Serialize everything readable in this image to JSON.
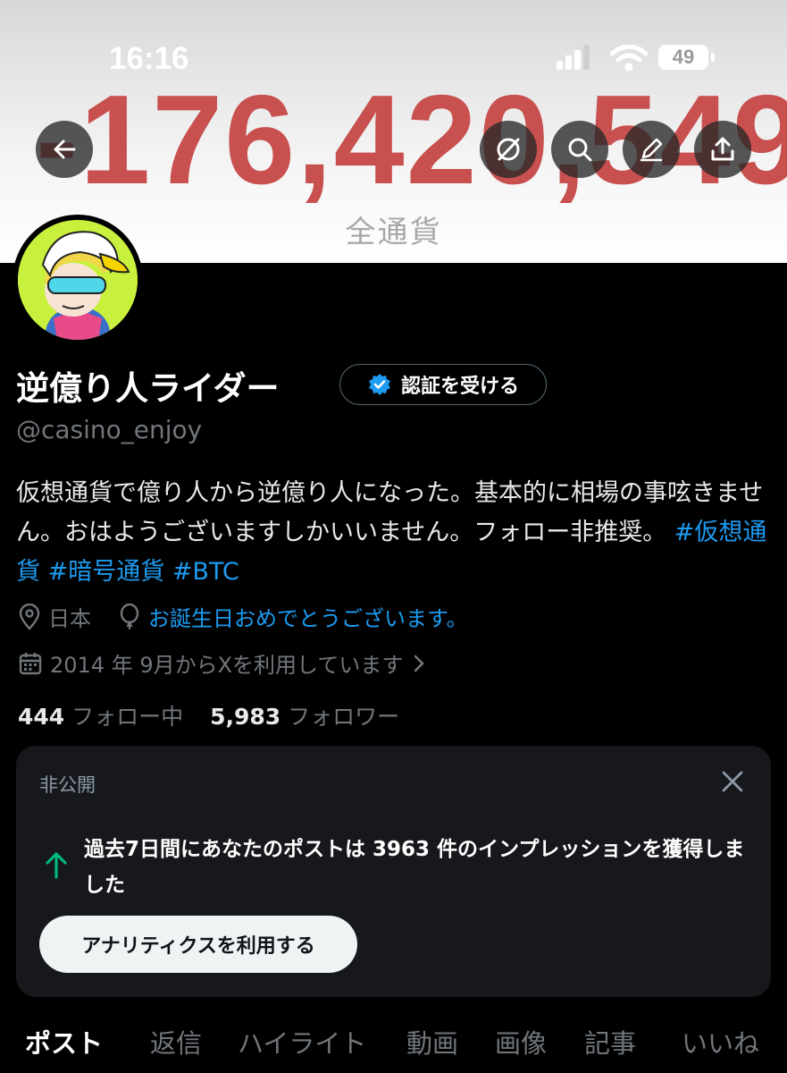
{
  "status_bar": {
    "time": "16:16",
    "battery": "49"
  },
  "banner": {
    "amount": "-176,420,549",
    "caption": "全通貨"
  },
  "header_icons": [
    "back-arrow-icon",
    "grok-icon",
    "search-icon",
    "compose-icon",
    "share-icon"
  ],
  "profile": {
    "display_name": "逆億り人ライダー",
    "verify_label": "認証を受ける",
    "handle": "@casino_enjoy",
    "bio_text": "仮想通貨で億り人から逆億り人になった。基本的に相場の事呟きません。おはようございますしかいいません。フォロー非推奨。",
    "hashtags": [
      "#仮想通貨",
      "#暗号通貨",
      "#BTC"
    ],
    "location": "日本",
    "birthday": "お誕生日おめでとうございます。",
    "joined": "2014 年 9月からXを利用しています",
    "following_count": "444",
    "following_label": "フォロー中",
    "followers_count": "5,983",
    "followers_label": "フォロワー"
  },
  "private_card": {
    "label": "非公開",
    "message": "過去7日間にあなたのポストは 3963 件のインプレッションを獲得しました",
    "button": "アナリティクスを利用する"
  },
  "tabs": [
    {
      "label": "ポスト",
      "active": true
    },
    {
      "label": "返信",
      "active": false
    },
    {
      "label": "ハイライト",
      "active": false
    },
    {
      "label": "動画",
      "active": false
    },
    {
      "label": "画像",
      "active": false
    },
    {
      "label": "記事",
      "active": false
    },
    {
      "label": "いいね",
      "active": false
    }
  ],
  "colors": {
    "accent": "#1d9bf0",
    "banner_text": "#c8504f",
    "impression_arrow": "#00ba7c"
  }
}
